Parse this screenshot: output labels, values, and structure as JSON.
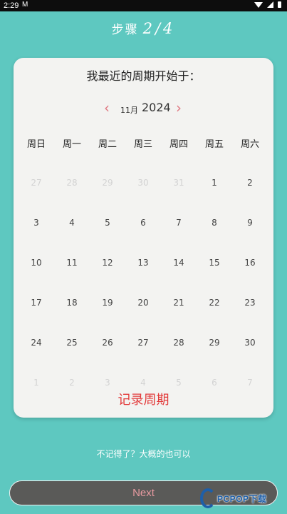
{
  "status_bar": {
    "time": "2:29",
    "mail_icon": "gmail-icon"
  },
  "header": {
    "step_label": "步骤",
    "step_value": "2/4"
  },
  "card": {
    "title": "我最近的周期开始于：",
    "month": "11月",
    "year": "2024",
    "weekdays": [
      "周日",
      "周一",
      "周二",
      "周三",
      "周四",
      "周五",
      "周六"
    ],
    "weeks": [
      [
        {
          "d": "27",
          "muted": true
        },
        {
          "d": "28",
          "muted": true
        },
        {
          "d": "29",
          "muted": true
        },
        {
          "d": "30",
          "muted": true
        },
        {
          "d": "31",
          "muted": true
        },
        {
          "d": "1",
          "muted": false
        },
        {
          "d": "2",
          "muted": false
        }
      ],
      [
        {
          "d": "3",
          "muted": false
        },
        {
          "d": "4",
          "muted": false
        },
        {
          "d": "5",
          "muted": false
        },
        {
          "d": "6",
          "muted": false
        },
        {
          "d": "7",
          "muted": false
        },
        {
          "d": "8",
          "muted": false
        },
        {
          "d": "9",
          "muted": false
        }
      ],
      [
        {
          "d": "10",
          "muted": false
        },
        {
          "d": "11",
          "muted": false
        },
        {
          "d": "12",
          "muted": false
        },
        {
          "d": "13",
          "muted": false
        },
        {
          "d": "14",
          "muted": false
        },
        {
          "d": "15",
          "muted": false
        },
        {
          "d": "16",
          "muted": false
        }
      ],
      [
        {
          "d": "17",
          "muted": false
        },
        {
          "d": "18",
          "muted": false
        },
        {
          "d": "19",
          "muted": false
        },
        {
          "d": "20",
          "muted": false
        },
        {
          "d": "21",
          "muted": false
        },
        {
          "d": "22",
          "muted": false
        },
        {
          "d": "23",
          "muted": false
        }
      ],
      [
        {
          "d": "24",
          "muted": false
        },
        {
          "d": "25",
          "muted": false
        },
        {
          "d": "26",
          "muted": false
        },
        {
          "d": "27",
          "muted": false
        },
        {
          "d": "28",
          "muted": false
        },
        {
          "d": "29",
          "muted": false
        },
        {
          "d": "30",
          "muted": false
        }
      ],
      [
        {
          "d": "1",
          "muted": true
        },
        {
          "d": "2",
          "muted": true
        },
        {
          "d": "3",
          "muted": true
        },
        {
          "d": "4",
          "muted": true
        },
        {
          "d": "5",
          "muted": true
        },
        {
          "d": "6",
          "muted": true
        },
        {
          "d": "7",
          "muted": true
        }
      ]
    ],
    "record_label": "记录周期"
  },
  "hint": "不记得了？大概的也可以",
  "next_label": "Next",
  "watermark": {
    "text": "PCPOP下载"
  },
  "colors": {
    "background": "#5ec8c0",
    "accent_red": "#e23a3a",
    "arrow_pink": "#e07a84",
    "button_bg": "#5a5a58"
  }
}
